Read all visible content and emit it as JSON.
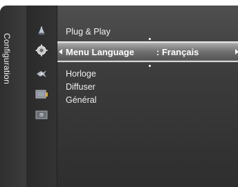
{
  "section": {
    "label": "Configuration"
  },
  "icons": [
    {
      "name": "picture-icon"
    },
    {
      "name": "settings-gear-icon"
    },
    {
      "name": "sound-icon"
    },
    {
      "name": "channel-icon"
    },
    {
      "name": "help-icon"
    }
  ],
  "menu": {
    "items": [
      {
        "label": "Plug & Play"
      },
      {
        "label": "Menu Language",
        "value": ": Français",
        "selected": true
      },
      {
        "label": "Horloge"
      },
      {
        "label": "Diffuser"
      },
      {
        "label": "Général"
      }
    ]
  },
  "colors": {
    "panel": "#3b3b3b",
    "text": "#f0f0f0",
    "highlight": "#6f6f6f"
  }
}
